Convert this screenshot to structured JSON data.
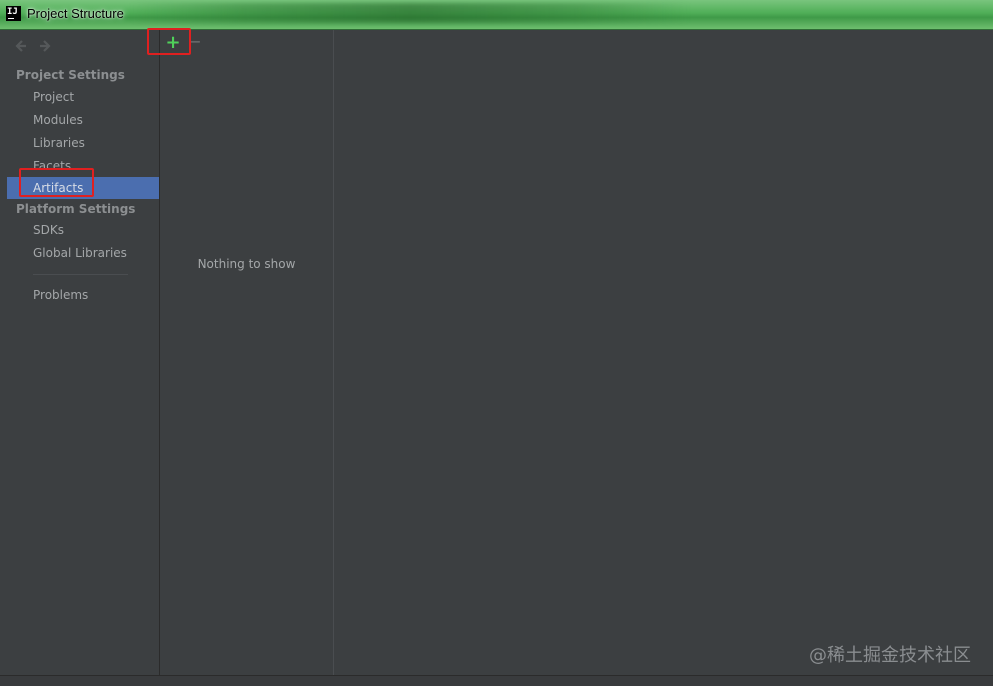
{
  "window": {
    "title": "Project Structure",
    "icon": "intellij-idea-icon"
  },
  "toolbar": {
    "back_icon": "arrow-left-icon",
    "forward_icon": "arrow-right-icon",
    "add_label": "+",
    "remove_label": "−"
  },
  "sidebar": {
    "project_settings_header": "Project Settings",
    "project_settings_items": [
      {
        "label": "Project"
      },
      {
        "label": "Modules"
      },
      {
        "label": "Libraries"
      },
      {
        "label": "Facets"
      },
      {
        "label": "Artifacts",
        "selected": true
      }
    ],
    "platform_settings_header": "Platform Settings",
    "platform_settings_items": [
      {
        "label": "SDKs"
      },
      {
        "label": "Global Libraries"
      }
    ],
    "problems_label": "Problems"
  },
  "list_panel": {
    "empty_text": "Nothing to show"
  },
  "watermark": "@稀土掘金技术社区",
  "colors": {
    "accent_selected": "#4b6eaf",
    "add_green": "#4fd15a",
    "annotation_red": "#e02020",
    "background": "#3c3f41"
  }
}
